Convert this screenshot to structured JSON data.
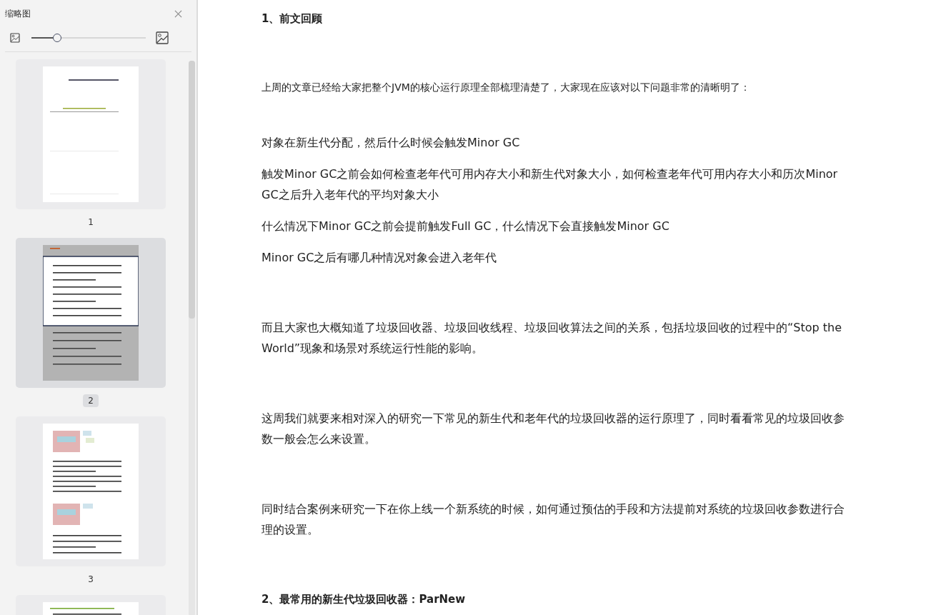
{
  "sidebar": {
    "title": "缩略图",
    "zoom_slider": {
      "level": 0.225
    },
    "thumbnails": [
      {
        "number": "1",
        "selected": false
      },
      {
        "number": "2",
        "selected": true
      },
      {
        "number": "3",
        "selected": false
      },
      {
        "selected": false
      }
    ]
  },
  "document": {
    "blocks": [
      {
        "kind": "heading",
        "text": "1、前文回顾"
      },
      {
        "kind": "lead",
        "text": "上周的文章已经给大家把整个JVM的核心运行原理全部梳理清楚了，大家现在应该对以下问题非常的清晰明了："
      },
      {
        "kind": "item",
        "text": "对象在新生代分配，然后什么时候会触发Minor GC"
      },
      {
        "kind": "item",
        "text": "触发Minor GC之前会如何检查老年代可用内存大小和新生代对象大小，如何检查老年代可用内存大小和历次Minor GC之后升入老年代的平均对象大小"
      },
      {
        "kind": "item",
        "text": "什么情况下Minor GC之前会提前触发Full GC，什么情况下会直接触发Minor GC"
      },
      {
        "kind": "item",
        "text": "Minor GC之后有哪几种情况对象会进入老年代"
      },
      {
        "kind": "para",
        "text": "而且大家也大概知道了垃圾回收器、垃圾回收线程、垃圾回收算法之间的关系，包括垃圾回收的过程中的“Stop the World”现象和场景对系统运行性能的影响。"
      },
      {
        "kind": "para",
        "text": "这周我们就要来相对深入的研究一下常见的新生代和老年代的垃圾回收器的运行原理了，同时看看常见的垃圾回收参数一般会怎么来设置。"
      },
      {
        "kind": "para",
        "text": "同时结合案例来研究一下在你上线一个新系统的时候，如何通过预估的手段和方法提前对系统的垃圾回收参数进行合理的设置。"
      },
      {
        "kind": "heading",
        "text": "2、最常用的新生代垃圾回收器：ParNew"
      }
    ]
  }
}
